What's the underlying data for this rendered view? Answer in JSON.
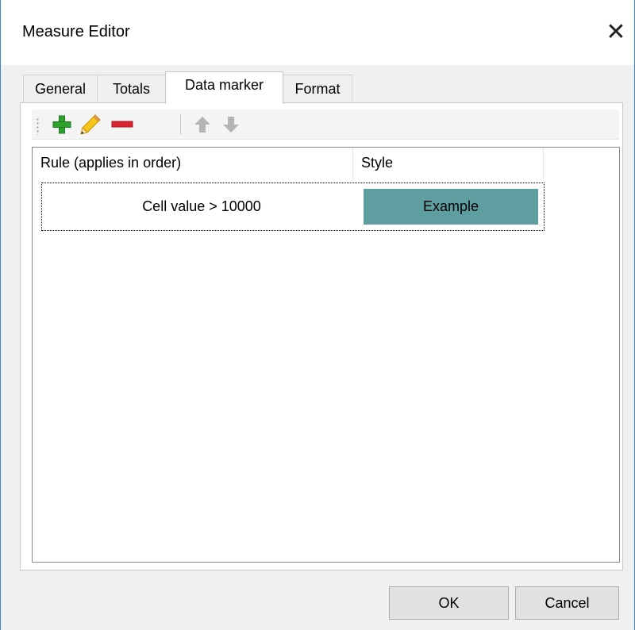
{
  "window": {
    "title": "Measure Editor",
    "close_symbol": "✕"
  },
  "tabs": [
    {
      "label": "General",
      "active": false
    },
    {
      "label": "Totals",
      "active": false
    },
    {
      "label": "Data marker",
      "active": true
    },
    {
      "label": "Format",
      "active": false
    }
  ],
  "toolbar": {
    "buttons": [
      {
        "name": "add",
        "icon": "plus-icon",
        "color": "#2ea02e",
        "enabled": true
      },
      {
        "name": "edit",
        "icon": "pencil-icon",
        "color": "#f0c419",
        "enabled": true
      },
      {
        "name": "remove",
        "icon": "minus-icon",
        "color": "#d9232d",
        "enabled": true
      },
      {
        "name": "move-up",
        "icon": "arrow-up-icon",
        "color": "#b4b4b4",
        "enabled": false
      },
      {
        "name": "move-down",
        "icon": "arrow-down-icon",
        "color": "#b4b4b4",
        "enabled": false
      }
    ]
  },
  "rules_table": {
    "columns": [
      "Rule (applies in order)",
      "Style"
    ],
    "rows": [
      {
        "rule": "Cell value > 10000",
        "style_text": "Example",
        "style_background": "#5f9ea0"
      }
    ]
  },
  "footer": {
    "ok_label": "OK",
    "cancel_label": "Cancel"
  }
}
